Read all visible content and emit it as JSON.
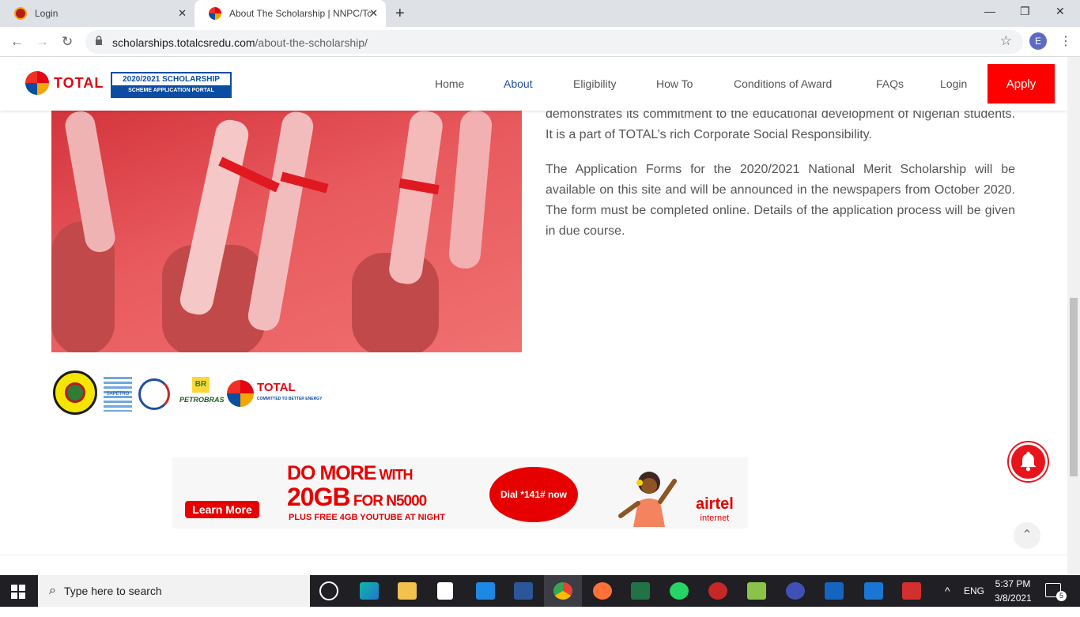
{
  "browser": {
    "tabs": [
      {
        "title": "Login",
        "close": "✕"
      },
      {
        "title": "About The Scholarship | NNPC/Tc",
        "close": "✕"
      }
    ],
    "new_tab": "+",
    "window_controls": {
      "minimize": "—",
      "restore": "❐",
      "close": "✕"
    },
    "back": "←",
    "forward": "→",
    "reload": "↻",
    "url_host": "scholarships.totalcsredu.com",
    "url_path": "/about-the-scholarship/",
    "bookmark": "☆",
    "profile_initial": "E",
    "menu": "⋮"
  },
  "site": {
    "logo_text": "TOTAL",
    "badge_top": "2020/2021 SCHOLARSHIP",
    "badge_bottom": "SCHEME APPLICATION PORTAL",
    "nav": [
      "Home",
      "About",
      "Eligibility",
      "How To",
      "Conditions of Award",
      "FAQs",
      "Login"
    ],
    "active_nav": "About",
    "apply_label": "Apply"
  },
  "content": {
    "para1_partial": "demonstrates its commitment to the educational development of Nigerian students. It is a part of TOTAL’s rich Corporate Social Responsibility.",
    "para2": "The Application Forms for the 2020/2021 National Merit Scholarship will be available on this site and will be announced in the newspapers from October 2020. The form must be completed online. Details of the application process will be given in due course."
  },
  "sponsors": {
    "sapetro": "SAPETRO",
    "petrobras_mark": "BR",
    "petrobras": "PETROBRAS",
    "total": "TOTAL",
    "total_tagline": "COMMITTED TO BETTER ENERGY"
  },
  "ad": {
    "learn_more": "Learn More",
    "line1_a": "DO MORE",
    "line1_b": " WITH",
    "line2_a": "20GB",
    "line2_b": " FOR N5000",
    "line3": "PLUS FREE 4GB YOUTUBE AT NIGHT",
    "dial": "Dial *141# now",
    "brand": "airtel",
    "brand_sub": "internet"
  },
  "widgets": {
    "scroll_top": "⌃"
  },
  "taskbar": {
    "search_placeholder": "Type here to search",
    "language": "ENG",
    "time": "5:37 PM",
    "date": "3/8/2021",
    "notifications": "5",
    "tray_up": "^"
  },
  "colors": {
    "brand_red": "#ff0000",
    "nav_active": "#1f4e9e",
    "ad_red": "#e60000"
  }
}
